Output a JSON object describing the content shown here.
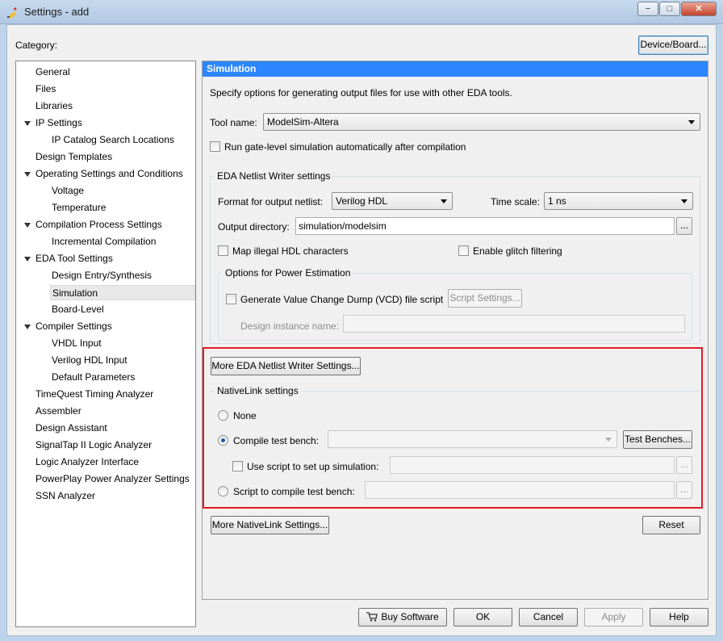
{
  "window": {
    "title": "Settings - add"
  },
  "category_label": "Category:",
  "device_board_button": "Device/Board...",
  "tree": [
    {
      "label": "General",
      "level": 0,
      "expandable": false
    },
    {
      "label": "Files",
      "level": 0,
      "expandable": false
    },
    {
      "label": "Libraries",
      "level": 0,
      "expandable": false
    },
    {
      "label": "IP Settings",
      "level": 0,
      "expandable": true
    },
    {
      "label": "IP Catalog Search Locations",
      "level": 1,
      "expandable": false
    },
    {
      "label": "Design Templates",
      "level": 0,
      "expandable": false
    },
    {
      "label": "Operating Settings and Conditions",
      "level": 0,
      "expandable": true
    },
    {
      "label": "Voltage",
      "level": 1,
      "expandable": false
    },
    {
      "label": "Temperature",
      "level": 1,
      "expandable": false
    },
    {
      "label": "Compilation Process Settings",
      "level": 0,
      "expandable": true
    },
    {
      "label": "Incremental Compilation",
      "level": 1,
      "expandable": false
    },
    {
      "label": "EDA Tool Settings",
      "level": 0,
      "expandable": true
    },
    {
      "label": "Design Entry/Synthesis",
      "level": 1,
      "expandable": false
    },
    {
      "label": "Simulation",
      "level": 1,
      "expandable": false,
      "selected": true
    },
    {
      "label": "Board-Level",
      "level": 1,
      "expandable": false
    },
    {
      "label": "Compiler Settings",
      "level": 0,
      "expandable": true
    },
    {
      "label": "VHDL Input",
      "level": 1,
      "expandable": false
    },
    {
      "label": "Verilog HDL Input",
      "level": 1,
      "expandable": false
    },
    {
      "label": "Default Parameters",
      "level": 1,
      "expandable": false
    },
    {
      "label": "TimeQuest Timing Analyzer",
      "level": 0,
      "expandable": false
    },
    {
      "label": "Assembler",
      "level": 0,
      "expandable": false
    },
    {
      "label": "Design Assistant",
      "level": 0,
      "expandable": false
    },
    {
      "label": "SignalTap II Logic Analyzer",
      "level": 0,
      "expandable": false
    },
    {
      "label": "Logic Analyzer Interface",
      "level": 0,
      "expandable": false
    },
    {
      "label": "PowerPlay Power Analyzer Settings",
      "level": 0,
      "expandable": false
    },
    {
      "label": "SSN Analyzer",
      "level": 0,
      "expandable": false
    }
  ],
  "panel": {
    "title": "Simulation",
    "description": "Specify options for generating output files for use with other EDA tools.",
    "tool_name_label": "Tool name:",
    "tool_name_value": "ModelSim-Altera",
    "run_gate_level_label": "Run gate-level simulation automatically after compilation",
    "run_gate_level_checked": false,
    "eda_netlist": {
      "group_title": "EDA Netlist Writer settings",
      "format_label": "Format for output netlist:",
      "format_value": "Verilog HDL",
      "time_scale_label": "Time scale:",
      "time_scale_value": "1 ns",
      "output_dir_label": "Output directory:",
      "output_dir_value": "simulation/modelsim",
      "map_illegal_label": "Map illegal HDL characters",
      "enable_glitch_label": "Enable glitch filtering",
      "power_group_title": "Options for Power Estimation",
      "vcd_label": "Generate Value Change Dump (VCD) file script",
      "script_settings_button": "Script Settings...",
      "design_instance_label": "Design instance name:",
      "design_instance_value": ""
    },
    "more_eda_button": "More EDA Netlist Writer Settings...",
    "nativelink": {
      "group_title": "NativeLink settings",
      "none_label": "None",
      "compile_tb_label": "Compile test bench:",
      "compile_tb_value": "",
      "test_benches_button": "Test Benches...",
      "use_script_label": "Use script to set up simulation:",
      "use_script_value": "",
      "script_compile_label": "Script to compile test bench:",
      "script_compile_value": "",
      "selected": "compile_test_bench"
    },
    "more_nativelink_button": "More NativeLink Settings...",
    "reset_button": "Reset"
  },
  "footer": {
    "buy_software": "Buy Software",
    "ok": "OK",
    "cancel": "Cancel",
    "apply": "Apply",
    "help": "Help"
  },
  "ellipsis": "...",
  "window_controls": {
    "minimize": "−",
    "maximize": "□",
    "close": "✕"
  }
}
